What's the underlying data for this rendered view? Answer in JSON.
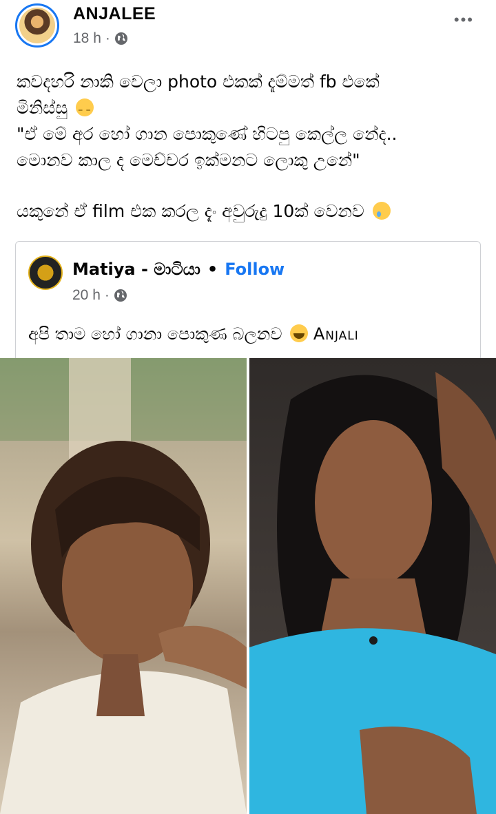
{
  "post": {
    "author": "ANJALEE",
    "time": "18 h",
    "privacy_icon": "globe-icon",
    "more_label": "•••",
    "text_lines": [
      "කවදහරි නාකි වෙලා photo එකක් දැම්මත් fb එකේ",
      "මිනිස්සු",
      "\"ඒ මේ අර හෝ ගාන පොකුණේ හිටපු කෙල්ල නේද..",
      "මොනව කාල ද මෙච්චර ඉක්මනට ලොකු උනේ\"",
      "යකුනේ ඒ film එක කරල දැං අවුරුදු 10ක් වෙනව"
    ]
  },
  "shared": {
    "page_name": "Matiya - මාටියා",
    "separator": "•",
    "follow_label": "Follow",
    "time": "20 h",
    "text": "අපි තාම හෝ ගානා පොකුණ බලනව",
    "mention": "Anjali"
  },
  "colors": {
    "accent": "#1877f2",
    "meta_text": "#65676b"
  }
}
